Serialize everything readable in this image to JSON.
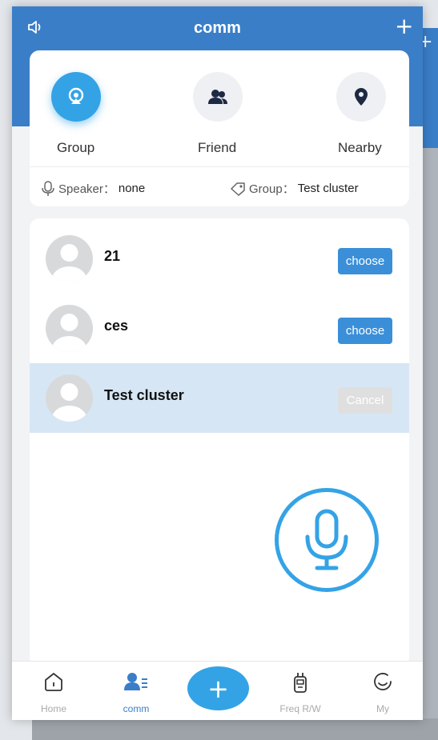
{
  "app": {
    "title": "comm",
    "add_icon": "plus-icon",
    "speaker_icon": "speaker-icon"
  },
  "tabs": [
    {
      "label": "Group",
      "icon": "group-icon",
      "active": true
    },
    {
      "label": "Friend",
      "icon": "friend-icon",
      "active": false
    },
    {
      "label": "Nearby",
      "icon": "location-pin-icon",
      "active": false
    }
  ],
  "info": {
    "speaker_label": "Speaker：",
    "speaker_value": "none",
    "group_label": "Group：",
    "group_value": "Test cluster"
  },
  "list": [
    {
      "name": "21",
      "button": "choose",
      "selected": false
    },
    {
      "name": "ces",
      "button": "choose",
      "selected": false
    },
    {
      "name": "Test cluster",
      "button": "Cancel",
      "selected": true
    }
  ],
  "bottom_nav": [
    {
      "label": "Home",
      "icon": "home-icon"
    },
    {
      "label": "comm",
      "icon": "contacts-icon",
      "active": true
    },
    {
      "label": "Freq R/W",
      "icon": "walkie-talkie-icon"
    },
    {
      "label": "My",
      "icon": "smile-icon"
    }
  ],
  "colors": {
    "primary": "#3a7ec8",
    "accent": "#34a3e6",
    "selected_row": "#d7e6f5"
  }
}
